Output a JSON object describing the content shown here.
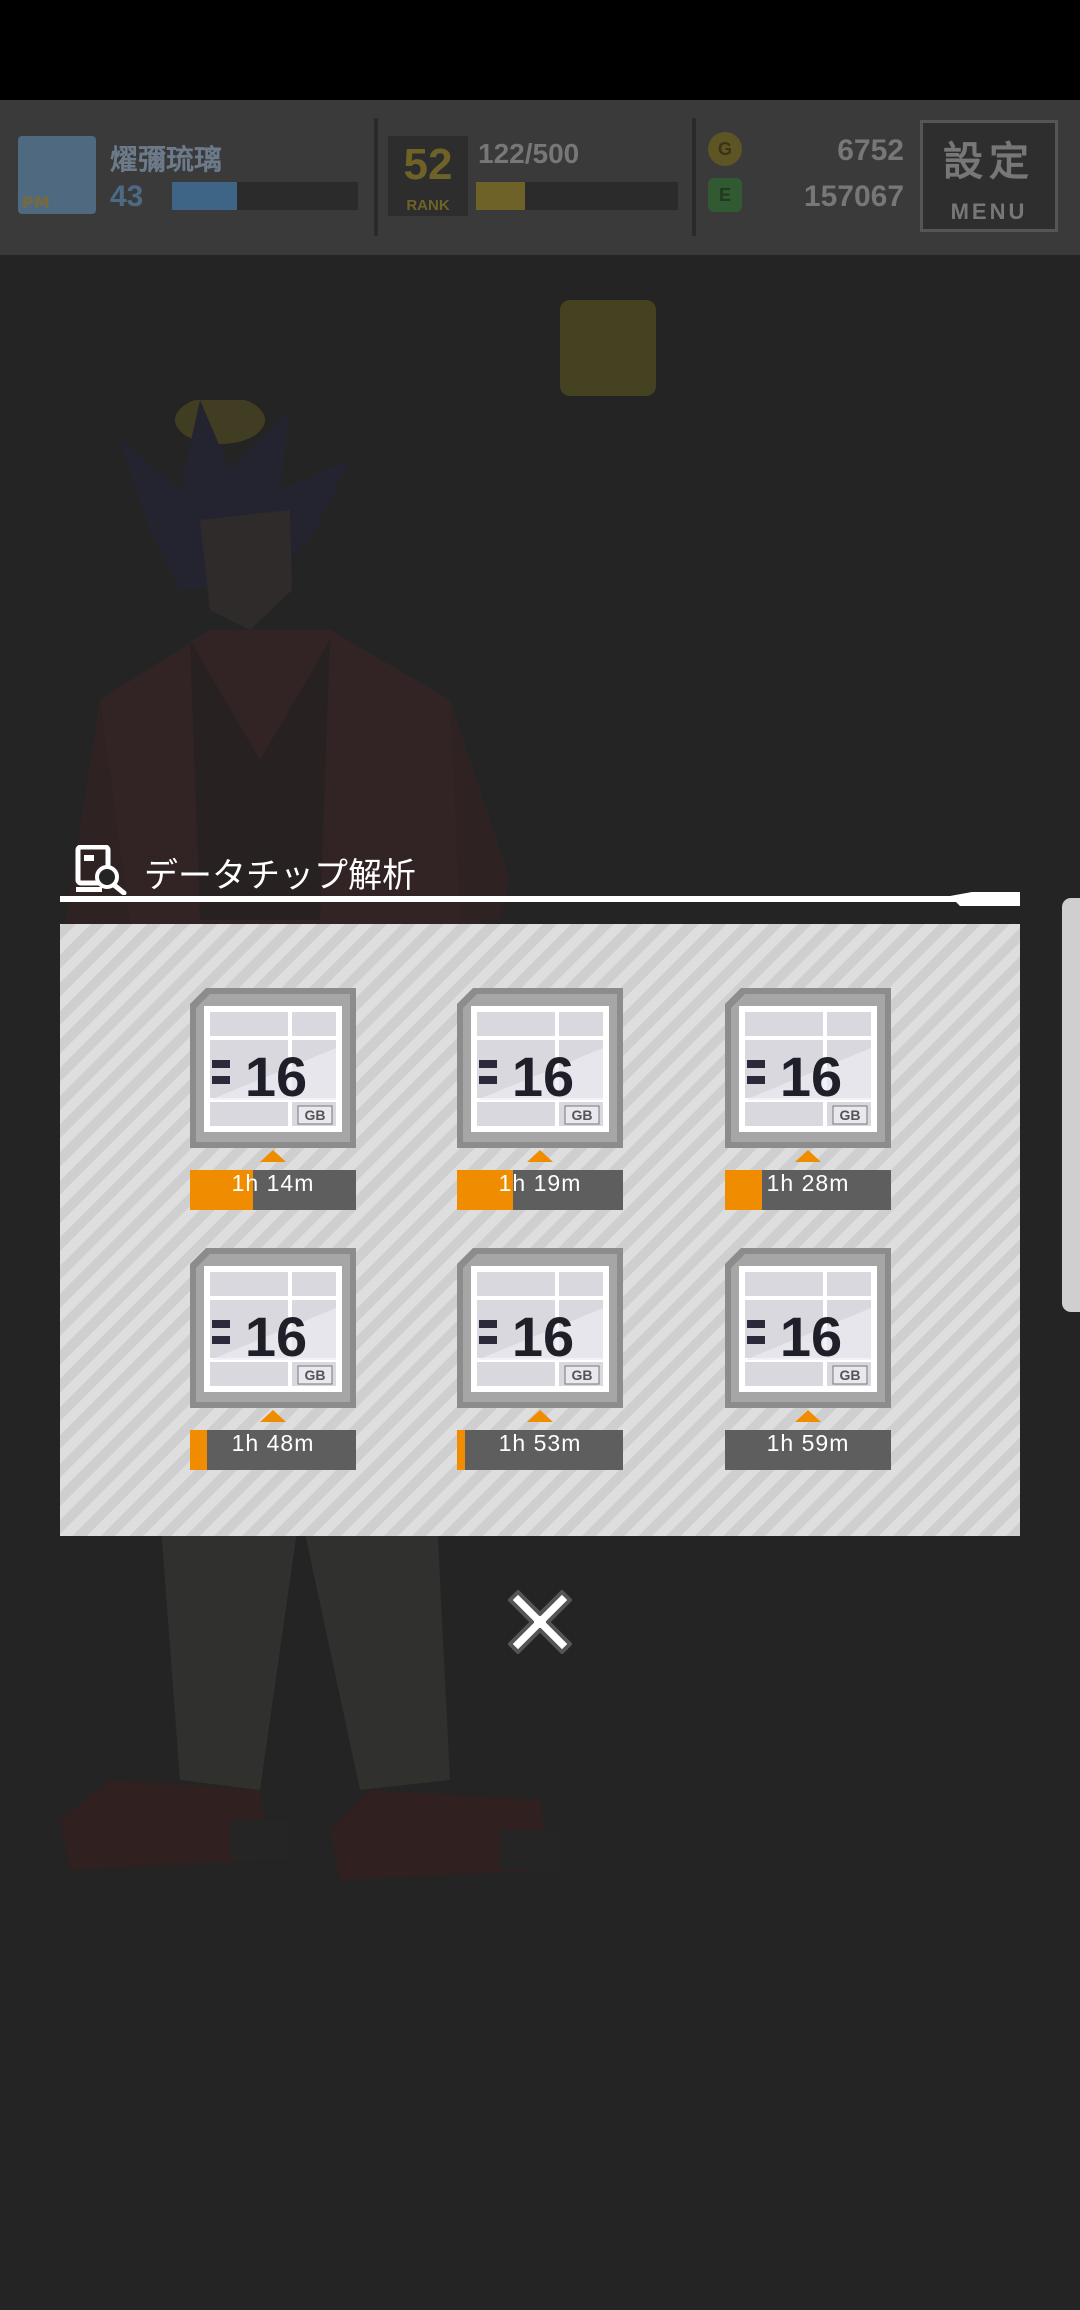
{
  "hud": {
    "player_name": "燿彌琉璃",
    "player_level": "43",
    "level_progress": 0.35,
    "pm_badge": "PM",
    "rank_number": "52",
    "rank_label": "RANK",
    "exp_text": "122/500",
    "exp_progress": 0.244,
    "gold": "6752",
    "gold_icon": "G",
    "credits": "157067",
    "credit_icon": "E",
    "menu_kanji": "設定",
    "menu_label": "MENU"
  },
  "modal": {
    "title": "データチップ解析",
    "chips": [
      {
        "capacity": "16",
        "unit": "GB",
        "time": "1h 14m",
        "progress": 0.38
      },
      {
        "capacity": "16",
        "unit": "GB",
        "time": "1h 19m",
        "progress": 0.34
      },
      {
        "capacity": "16",
        "unit": "GB",
        "time": "1h 28m",
        "progress": 0.22
      },
      {
        "capacity": "16",
        "unit": "GB",
        "time": "1h 48m",
        "progress": 0.1
      },
      {
        "capacity": "16",
        "unit": "GB",
        "time": "1h 53m",
        "progress": 0.05
      },
      {
        "capacity": "16",
        "unit": "GB",
        "time": "1h 59m",
        "progress": 0.0
      }
    ]
  },
  "colors": {
    "accent": "#f08c00",
    "panel": "#d4d4d4",
    "background": "#242424"
  }
}
